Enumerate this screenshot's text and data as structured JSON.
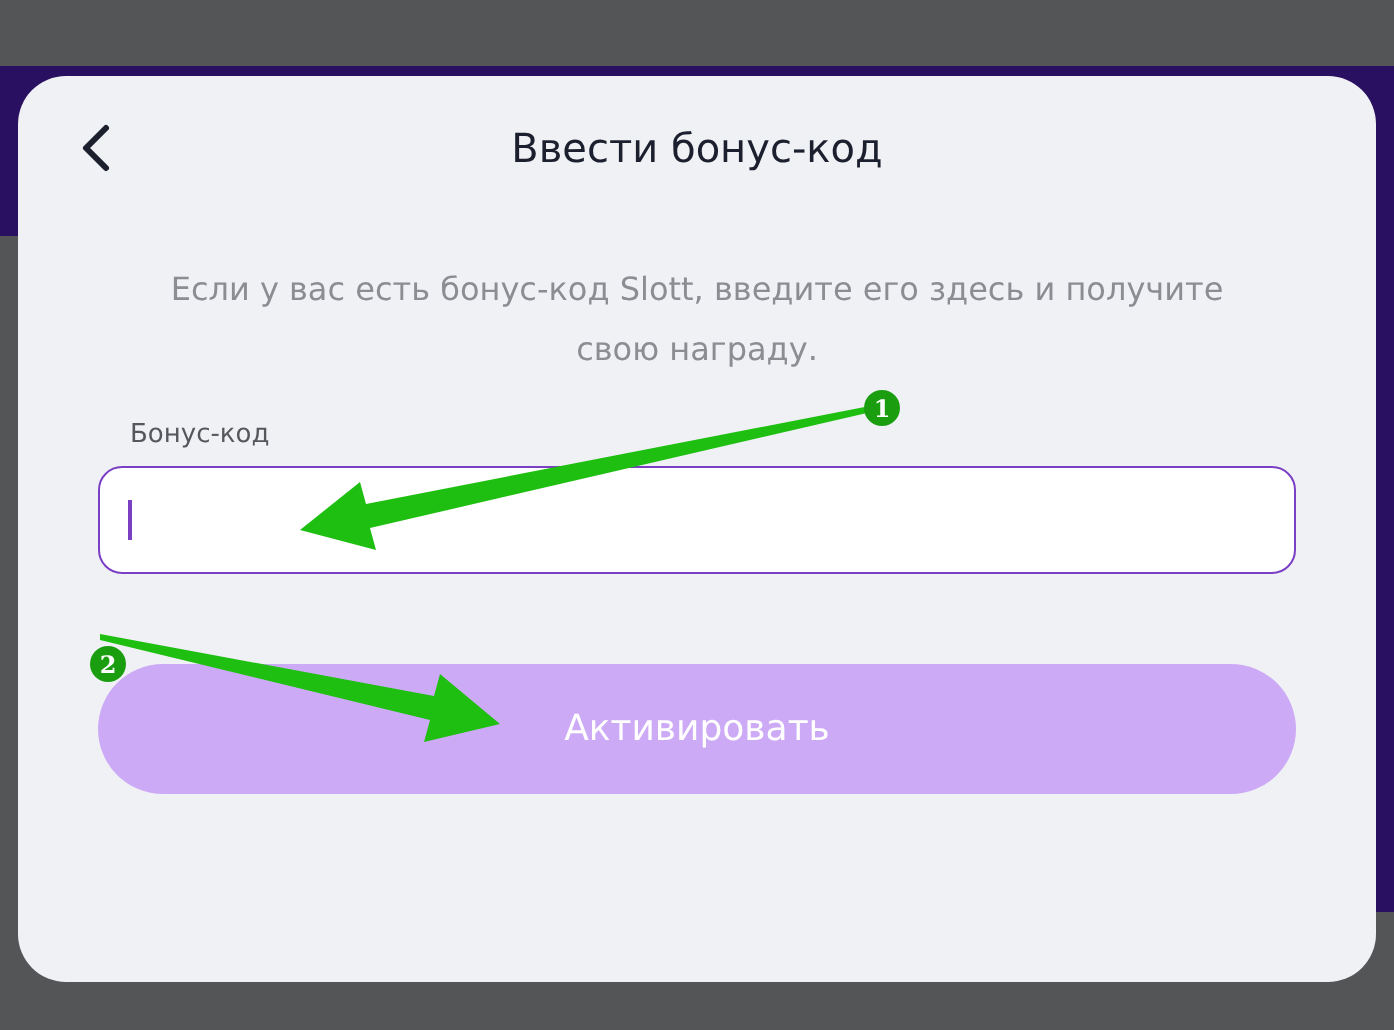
{
  "dialog": {
    "title": "Ввести бонус-код",
    "description": "Если у вас есть бонус-код Slott, введите его здесь и получите свою награду."
  },
  "field": {
    "label": "Бонус-код",
    "focused": true
  },
  "button": {
    "label": "Активировать",
    "disabled": true
  },
  "annotations": [
    {
      "number": "1"
    },
    {
      "number": "2"
    }
  ]
}
